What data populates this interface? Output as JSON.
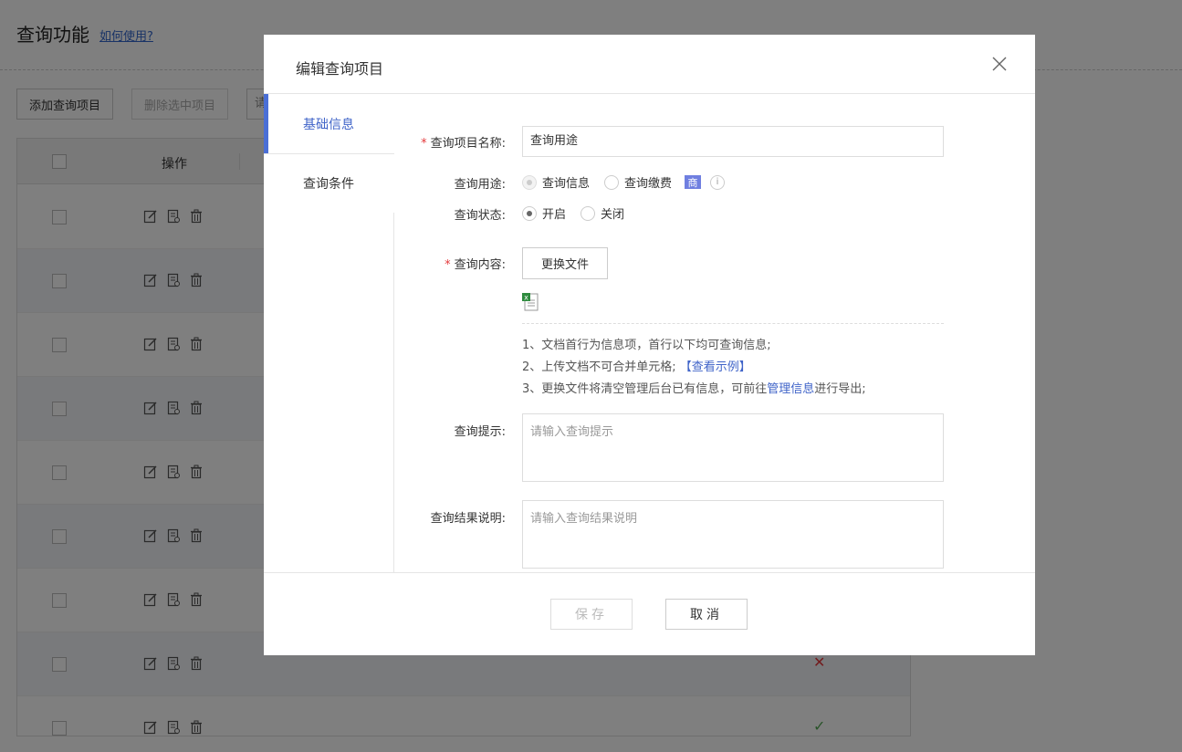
{
  "page": {
    "title": "查询功能",
    "help_link": "如何使用?",
    "toolbar": {
      "add_label": "添加查询项目",
      "delete_label": "删除选中项目",
      "search_stub": "请"
    },
    "table": {
      "col_ops": "操作",
      "rows": [
        {
          "status": ""
        },
        {
          "status": ""
        },
        {
          "status": ""
        },
        {
          "status": ""
        },
        {
          "status": ""
        },
        {
          "status": ""
        },
        {
          "status": ""
        },
        {
          "status": "✕"
        },
        {
          "status": "✓"
        }
      ]
    }
  },
  "modal": {
    "title": "编辑查询项目",
    "tabs": [
      {
        "label": "基础信息",
        "active": true
      },
      {
        "label": "查询条件",
        "active": false
      }
    ],
    "form": {
      "name_label": "查询项目名称:",
      "name_value": "查询用途",
      "purpose_label": "查询用途:",
      "purpose_options": [
        "查询信息",
        "查询缴费"
      ],
      "purpose_badge": "商",
      "purpose_info": "i",
      "status_label": "查询状态:",
      "status_options": [
        "开启",
        "关闭"
      ],
      "content_label": "查询内容:",
      "change_file_button": "更换文件",
      "file_icon": "excel-file-icon",
      "note1": "1、文档首行为信息项，首行以下均可查询信息;",
      "note2_prefix": "2、上传文档不可合并单元格;",
      "note2_link": "【查看示例】",
      "note3_prefix": "3、更换文件将清空管理后台已有信息，可前往",
      "note3_link": "管理信息",
      "note3_suffix": "进行导出;",
      "hint_label": "查询提示:",
      "hint_placeholder": "请输入查询提示",
      "result_label": "查询结果说明:",
      "result_placeholder": "请输入查询结果说明"
    },
    "footer": {
      "save_label": "保存",
      "cancel_label": "取消"
    }
  },
  "colors": {
    "accent": "#4a6fd6",
    "required": "#e4393c",
    "badge": "#6f7fe0",
    "status_fail": "#e4393c",
    "status_ok": "#52a852"
  }
}
